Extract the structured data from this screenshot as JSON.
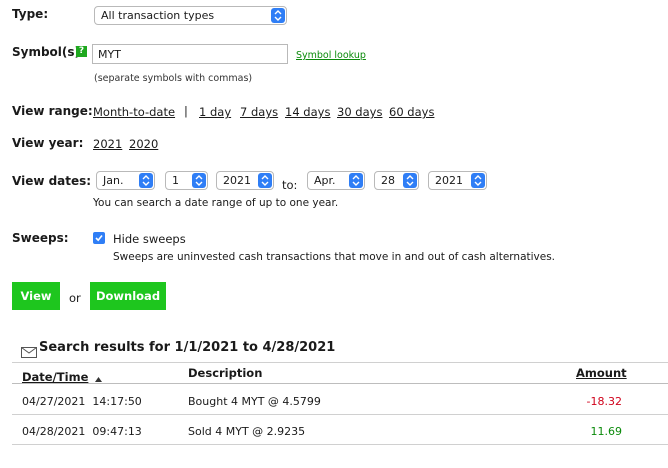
{
  "form": {
    "type": {
      "label": "Type:",
      "value": "All transaction types"
    },
    "symbols": {
      "label": "Symbol(s):",
      "help": "?",
      "value": "MYT",
      "lookup": "Symbol lookup",
      "hint": "(separate symbols with commas)"
    },
    "view_range": {
      "label": "View range:",
      "options": [
        "Month-to-date",
        "1 day",
        "7 days",
        "14 days",
        "30 days",
        "60 days"
      ],
      "separator": "|"
    },
    "view_year": {
      "label": "View year:",
      "options": [
        "2021",
        "2020"
      ]
    },
    "view_dates": {
      "label": "View dates:",
      "from": {
        "month": "Jan.",
        "day": "1",
        "year": "2021"
      },
      "to_label": "to:",
      "to": {
        "month": "Apr.",
        "day": "28",
        "year": "2021"
      },
      "note": "You can search a date range of up to one year."
    },
    "sweeps": {
      "label": "Sweeps:",
      "checkbox_label": "Hide sweeps",
      "checked": true,
      "description": "Sweeps are uninvested cash transactions that move in and out of cash alternatives."
    },
    "actions": {
      "view": "View",
      "or": "or",
      "download": "Download"
    }
  },
  "results": {
    "title": "Search results for 1/1/2021 to 4/28/2021",
    "columns": {
      "date_time": "Date/Time",
      "description": "Description",
      "amount": "Amount"
    },
    "rows": [
      {
        "date": "04/27/2021",
        "time": "14:17:50",
        "description": "Bought 4 MYT @ 4.5799",
        "amount": "-18.32"
      },
      {
        "date": "04/28/2021",
        "time": "09:47:13",
        "description": "Sold 4 MYT @ 2.9235",
        "amount": "11.69"
      }
    ]
  },
  "colors": {
    "accent_blue": "#2f7ef6",
    "button_green": "#1ec61e",
    "negative": "#d0021b",
    "positive": "#0a8a0a"
  },
  "icons": {
    "envelope": "envelope-icon",
    "sort": "sort-ascending-icon",
    "chevron": "chevron-updown-icon"
  }
}
